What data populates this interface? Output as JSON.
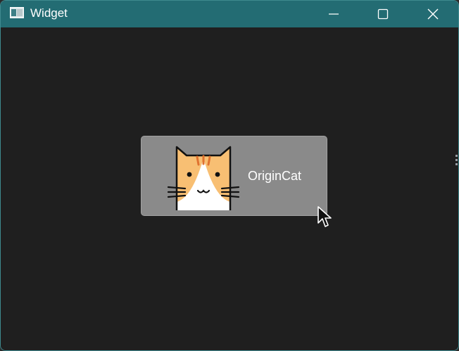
{
  "window": {
    "title": "Widget",
    "colors": {
      "titlebar": "#236c73",
      "content_background": "#1f1f1f",
      "button_background": "#8a8a8a"
    }
  },
  "titlebar": {
    "app_icon": "app-window-icon",
    "controls": [
      {
        "name": "minimize",
        "icon": "minimize-icon"
      },
      {
        "name": "maximize",
        "icon": "maximize-icon"
      },
      {
        "name": "close",
        "icon": "close-icon"
      }
    ]
  },
  "main": {
    "cat_button": {
      "label": "OriginCat",
      "icon": "cat-icon"
    }
  },
  "cursor": {
    "icon": "mouse-pointer-icon"
  }
}
